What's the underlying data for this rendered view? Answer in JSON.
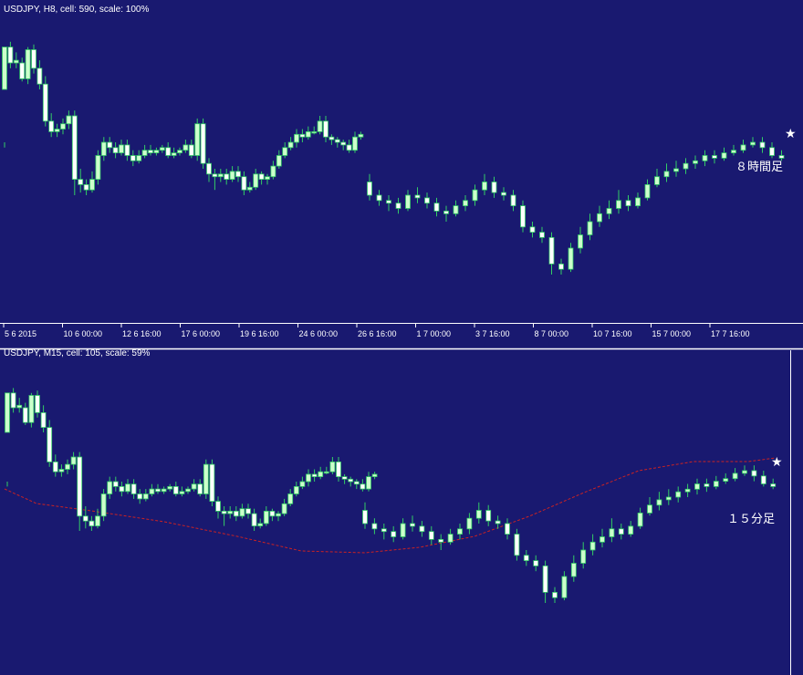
{
  "colors": {
    "background": "#191970",
    "wick": "#33cc66",
    "up_body": "#ccffcc",
    "down_body": "#ffffff",
    "ma": "#cc2222",
    "divider": "#ffffff",
    "marker": "#ffffff"
  },
  "chart_data": [
    {
      "type": "candlestick",
      "title": "USDJPY, H8, cell: 590, scale: 100%",
      "annotation": "８時間足",
      "marker": "★",
      "x_ticks": [
        "5 6 2015",
        "10 6 00:00",
        "12 6 16:00",
        "17 6 00:00",
        "19 6 16:00",
        "24 6 00:00",
        "26 6 16:00",
        "1 7 00:00",
        "3 7 16:00",
        "8 7 00:00",
        "10 7 16:00",
        "15 7 00:00",
        "17 7 16:00"
      ],
      "ylim": [
        0,
        100
      ],
      "candles": [
        [
          0,
          80,
          96,
          60,
          58
        ],
        [
          1,
          96,
          90,
          98,
          88
        ],
        [
          2,
          90,
          91,
          94,
          88
        ],
        [
          3,
          90,
          84,
          92,
          83
        ],
        [
          4,
          84,
          95,
          96,
          82
        ],
        [
          5,
          95,
          88,
          97,
          86
        ],
        [
          6,
          88,
          82,
          91,
          80
        ],
        [
          7,
          82,
          68,
          85,
          66
        ],
        [
          8,
          68,
          64,
          71,
          62
        ],
        [
          9,
          64,
          65,
          67,
          62
        ],
        [
          10,
          65,
          67,
          69,
          63
        ],
        [
          11,
          67,
          70,
          72,
          65
        ],
        [
          12,
          70,
          46,
          72,
          40
        ],
        [
          13,
          46,
          44,
          50,
          41
        ],
        [
          14,
          44,
          42,
          46,
          40
        ],
        [
          15,
          42,
          46,
          49,
          41
        ],
        [
          16,
          46,
          55,
          57,
          44
        ],
        [
          17,
          55,
          60,
          62,
          53
        ],
        [
          18,
          60,
          58,
          62,
          56
        ],
        [
          19,
          58,
          56,
          60,
          54
        ],
        [
          20,
          56,
          59,
          61,
          55
        ],
        [
          21,
          59,
          55,
          61,
          53
        ],
        [
          22,
          55,
          53,
          57,
          51
        ],
        [
          23,
          53,
          55,
          57,
          52
        ],
        [
          24,
          55,
          57,
          59,
          54
        ],
        [
          25,
          57,
          56,
          59,
          55
        ],
        [
          26,
          56,
          57,
          58,
          55
        ],
        [
          27,
          57,
          58,
          59,
          56
        ],
        [
          28,
          58,
          55,
          60,
          54
        ],
        [
          29,
          55,
          56,
          58,
          54
        ],
        [
          30,
          56,
          57,
          58,
          55
        ],
        [
          31,
          57,
          59,
          61,
          56
        ],
        [
          32,
          59,
          55,
          61,
          54
        ],
        [
          33,
          55,
          67,
          69,
          53
        ],
        [
          34,
          67,
          52,
          69,
          50
        ],
        [
          35,
          52,
          48,
          54,
          45
        ],
        [
          36,
          48,
          47,
          50,
          42
        ],
        [
          37,
          47,
          48,
          50,
          45
        ],
        [
          38,
          48,
          46,
          50,
          44
        ],
        [
          39,
          46,
          49,
          51,
          45
        ],
        [
          40,
          49,
          47,
          51,
          45
        ],
        [
          41,
          47,
          42,
          49,
          40
        ],
        [
          42,
          42,
          43,
          45,
          41
        ],
        [
          43,
          43,
          48,
          50,
          42
        ],
        [
          44,
          48,
          46,
          49,
          44
        ],
        [
          45,
          46,
          47,
          48,
          44
        ],
        [
          46,
          47,
          51,
          53,
          46
        ],
        [
          47,
          51,
          55,
          57,
          50
        ],
        [
          48,
          55,
          58,
          60,
          54
        ],
        [
          49,
          58,
          60,
          62,
          57
        ],
        [
          50,
          60,
          63,
          65,
          58
        ],
        [
          51,
          63,
          62,
          65,
          60
        ],
        [
          52,
          62,
          64,
          66,
          61
        ],
        [
          53,
          64,
          64,
          66,
          63
        ],
        [
          54,
          64,
          68,
          70,
          63
        ],
        [
          55,
          68,
          62,
          70,
          60
        ],
        [
          56,
          62,
          61,
          63,
          59
        ],
        [
          57,
          61,
          60,
          62,
          58
        ],
        [
          58,
          60,
          59,
          61,
          57
        ],
        [
          59,
          59,
          57,
          61,
          56
        ],
        [
          60,
          57,
          62,
          64,
          56
        ],
        [
          61,
          62,
          63,
          64,
          61
        ]
      ],
      "candles_b": [
        [
          0,
          45,
          40,
          48,
          38
        ],
        [
          1,
          40,
          38,
          42,
          36
        ],
        [
          2,
          38,
          37,
          40,
          34
        ],
        [
          3,
          37,
          35,
          39,
          33
        ],
        [
          4,
          35,
          40,
          42,
          34
        ],
        [
          5,
          40,
          39,
          43,
          37
        ],
        [
          6,
          39,
          37,
          41,
          35
        ],
        [
          7,
          37,
          34,
          39,
          32
        ],
        [
          8,
          34,
          33,
          36,
          30
        ],
        [
          9,
          33,
          36,
          38,
          32
        ],
        [
          10,
          36,
          38,
          40,
          34
        ],
        [
          11,
          38,
          42,
          44,
          36
        ],
        [
          12,
          42,
          45,
          48,
          40
        ],
        [
          13,
          45,
          41,
          47,
          39
        ],
        [
          14,
          41,
          40,
          43,
          38
        ],
        [
          15,
          40,
          36,
          42,
          34
        ],
        [
          16,
          36,
          28,
          38,
          26
        ],
        [
          17,
          28,
          26,
          30,
          24
        ],
        [
          18,
          26,
          24,
          28,
          22
        ],
        [
          19,
          24,
          14,
          26,
          10
        ],
        [
          20,
          14,
          12,
          16,
          10
        ],
        [
          21,
          12,
          20,
          22,
          11
        ],
        [
          22,
          20,
          25,
          28,
          18
        ],
        [
          23,
          25,
          30,
          33,
          23
        ],
        [
          24,
          30,
          33,
          36,
          28
        ],
        [
          25,
          33,
          35,
          38,
          31
        ],
        [
          26,
          35,
          38,
          42,
          33
        ],
        [
          27,
          38,
          36,
          40,
          34
        ],
        [
          28,
          36,
          39,
          41,
          35
        ],
        [
          29,
          39,
          44,
          46,
          38
        ],
        [
          30,
          44,
          47,
          50,
          43
        ],
        [
          31,
          47,
          49,
          52,
          45
        ],
        [
          32,
          49,
          50,
          53,
          47
        ],
        [
          33,
          50,
          52,
          54,
          48
        ],
        [
          34,
          52,
          53,
          55,
          50
        ],
        [
          35,
          53,
          55,
          57,
          51
        ],
        [
          36,
          55,
          54,
          57,
          52
        ],
        [
          37,
          54,
          56,
          58,
          53
        ],
        [
          38,
          56,
          57,
          59,
          55
        ],
        [
          39,
          57,
          59,
          61,
          56
        ],
        [
          40,
          59,
          60,
          62,
          58
        ],
        [
          41,
          60,
          58,
          62,
          56
        ],
        [
          42,
          58,
          55,
          60,
          54
        ],
        [
          43,
          55,
          54,
          57,
          53
        ]
      ]
    },
    {
      "type": "candlestick",
      "title": "USDJPY, M15, cell: 105, scale: 59%",
      "annotation": "１５分足",
      "marker": "★",
      "series": [
        {
          "name": "",
          "type": "moving-average"
        }
      ],
      "ylim": [
        0,
        100
      ]
    }
  ]
}
